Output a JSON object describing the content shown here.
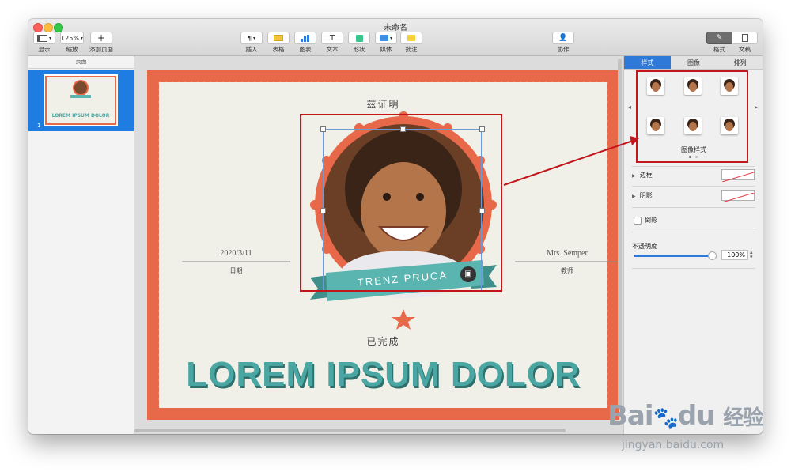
{
  "window": {
    "title": "未命名"
  },
  "toolbar": {
    "view_label": "显示",
    "zoom_value": "125%",
    "zoom_label": "缩放",
    "add_page_label": "添加页面",
    "insert_label": "插入",
    "table_label": "表格",
    "chart_label": "图表",
    "text_label": "文本",
    "shape_label": "形状",
    "media_label": "媒体",
    "comment_label": "批注",
    "collaborate_label": "协作",
    "format_label": "格式",
    "document_label": "文稿"
  },
  "sidebar": {
    "header": "页面",
    "page_number": "1",
    "thumb_title": "LOREM IPSUM DOLOR"
  },
  "certificate": {
    "heading": "兹证明",
    "name_ribbon": "TRENZ PRUCA",
    "date_value": "2020/3/11",
    "date_label": "日期",
    "teacher_value": "Mrs. Semper",
    "teacher_label": "教师",
    "completed_label": "已完成",
    "main_title": "LOREM IPSUM DOLOR"
  },
  "panel": {
    "tabs": [
      "样式",
      "图像",
      "排列"
    ],
    "active_tab": "样式",
    "image_styles_label": "图像样式",
    "border_label": "边框",
    "shadow_label": "阴影",
    "reflection_label": "倒影",
    "opacity_label": "不透明度",
    "opacity_value": "100%"
  },
  "watermark": {
    "brand": "Bai",
    "brand2": "du",
    "cn": "经验",
    "url": "jingyan.baidu.com"
  },
  "colors": {
    "accent": "#2f7ad8",
    "frame": "#e8684a",
    "teal": "#4aa6a3",
    "annotation": "#c0161c"
  }
}
